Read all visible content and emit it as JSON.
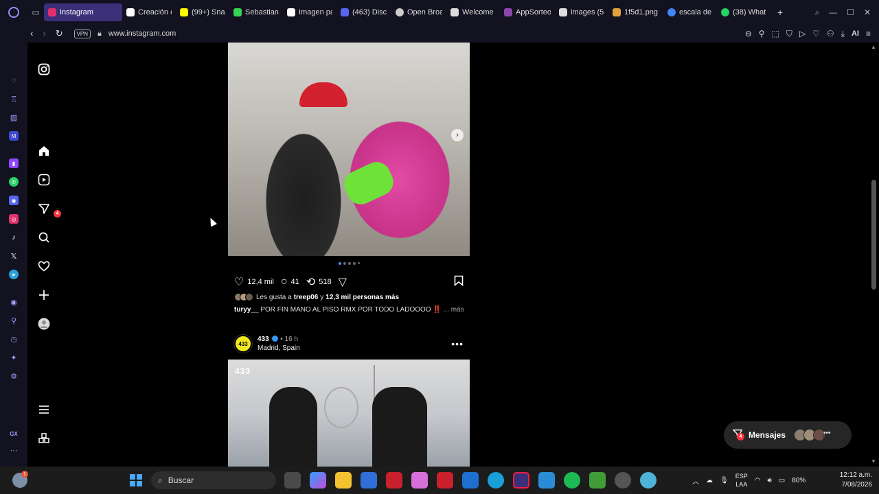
{
  "browser": {
    "tabs": [
      {
        "label": "Instagram",
        "color": "#e1306c",
        "active": true
      },
      {
        "label": "Creación d",
        "color": "#ffffff"
      },
      {
        "label": "(99+) Sna",
        "color": "#fffc00"
      },
      {
        "label": "Sebastian",
        "color": "#39d353"
      },
      {
        "label": "Imagen pa",
        "color": "#ffffff"
      },
      {
        "label": "(463) Disc",
        "color": "#5865f2"
      },
      {
        "label": "Open Broa",
        "color": "#cccccc"
      },
      {
        "label": "Welcome",
        "color": "#dddddd"
      },
      {
        "label": "AppSorteo",
        "color": "#8e44ad"
      },
      {
        "label": "images (5",
        "color": "#dddddd"
      },
      {
        "label": "1f5d1.png",
        "color": "#e2a23b"
      },
      {
        "label": "escala de",
        "color": "#4285f4"
      },
      {
        "label": "(38) What",
        "color": "#25d366"
      }
    ],
    "vpn_label": "VPN",
    "url": "www.instagram.com",
    "ai_label": "AI"
  },
  "post1": {
    "likes_count": "12,4 mil",
    "comments_count": "41",
    "reposts_count": "518",
    "liked_by_prefix": "Les gusta a",
    "liked_by_user": "treep06",
    "liked_by_middle": "y",
    "liked_by_others": "12,3 mil personas más",
    "caption_user": "turyy__",
    "caption_text": "POR FIN MANO AL PISO RMX POR TODO LADOOOO ‼️",
    "caption_more": "... más"
  },
  "post2": {
    "avatar_text": "433",
    "username": "433",
    "time": "• 16 h",
    "location": "Madrid, Spain",
    "image_tag": "433"
  },
  "nav": {
    "messages_badge": "4"
  },
  "messages": {
    "label": "Mensajes",
    "badge": "4"
  },
  "taskbar": {
    "search_label": "Buscar",
    "weather_badge": "1",
    "lang_top": "ESP",
    "lang_bottom": "LAA",
    "battery": "80%",
    "time": "12:12 a.m.",
    "date": "7/08/2026"
  }
}
